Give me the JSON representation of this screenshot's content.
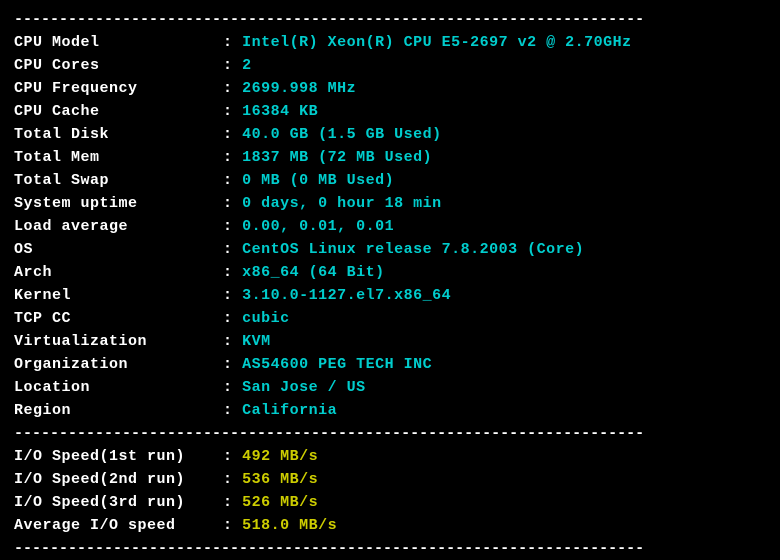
{
  "divider": "----------------------------------------------------------------------",
  "system": [
    {
      "label": "CPU Model",
      "value": "Intel(R) Xeon(R) CPU E5-2697 v2 @ 2.70GHz"
    },
    {
      "label": "CPU Cores",
      "value": "2"
    },
    {
      "label": "CPU Frequency",
      "value": "2699.998 MHz"
    },
    {
      "label": "CPU Cache",
      "value": "16384 KB"
    },
    {
      "label": "Total Disk",
      "value": "40.0 GB (1.5 GB Used)"
    },
    {
      "label": "Total Mem",
      "value": "1837 MB (72 MB Used)"
    },
    {
      "label": "Total Swap",
      "value": "0 MB (0 MB Used)"
    },
    {
      "label": "System uptime",
      "value": "0 days, 0 hour 18 min"
    },
    {
      "label": "Load average",
      "value": "0.00, 0.01, 0.01"
    },
    {
      "label": "OS",
      "value": "CentOS Linux release 7.8.2003 (Core)"
    },
    {
      "label": "Arch",
      "value": "x86_64 (64 Bit)"
    },
    {
      "label": "Kernel",
      "value": "3.10.0-1127.el7.x86_64"
    },
    {
      "label": "TCP CC",
      "value": "cubic"
    },
    {
      "label": "Virtualization",
      "value": "KVM"
    },
    {
      "label": "Organization",
      "value": "AS54600 PEG TECH INC"
    },
    {
      "label": "Location",
      "value": "San Jose / US"
    },
    {
      "label": "Region",
      "value": "California"
    }
  ],
  "io": [
    {
      "label": "I/O Speed(1st run)",
      "value": "492 MB/s"
    },
    {
      "label": "I/O Speed(2nd run)",
      "value": "536 MB/s"
    },
    {
      "label": "I/O Speed(3rd run)",
      "value": "526 MB/s"
    },
    {
      "label": "Average I/O speed",
      "value": "518.0 MB/s"
    }
  ]
}
